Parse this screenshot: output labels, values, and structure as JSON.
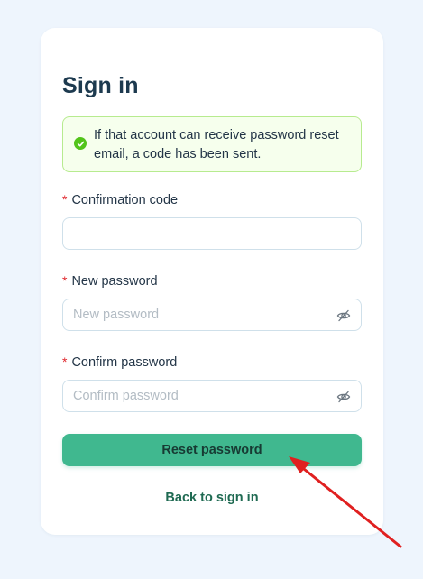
{
  "page": {
    "title": "Sign in"
  },
  "alert": {
    "type": "success",
    "icon": "check-circle-icon",
    "message": "If that account can receive password reset email, a code has been sent."
  },
  "form": {
    "required_mark": "*",
    "confirmation_code": {
      "label": "Confirmation code",
      "value": "",
      "placeholder": ""
    },
    "new_password": {
      "label": "New password",
      "value": "",
      "placeholder": "New password",
      "toggle_icon": "eye-slash-icon"
    },
    "confirm_password": {
      "label": "Confirm password",
      "value": "",
      "placeholder": "Confirm password",
      "toggle_icon": "eye-slash-icon"
    }
  },
  "actions": {
    "reset_label": "Reset password",
    "back_label": "Back to sign in"
  },
  "colors": {
    "background": "#eef5fd",
    "card": "#ffffff",
    "primary_button": "#40b88f",
    "link": "#1f6a52",
    "alert_bg": "#f6ffed",
    "alert_border": "#b7eb8f",
    "alert_icon": "#52c41a",
    "required": "#e0282e",
    "annotation_arrow": "#e02020"
  }
}
